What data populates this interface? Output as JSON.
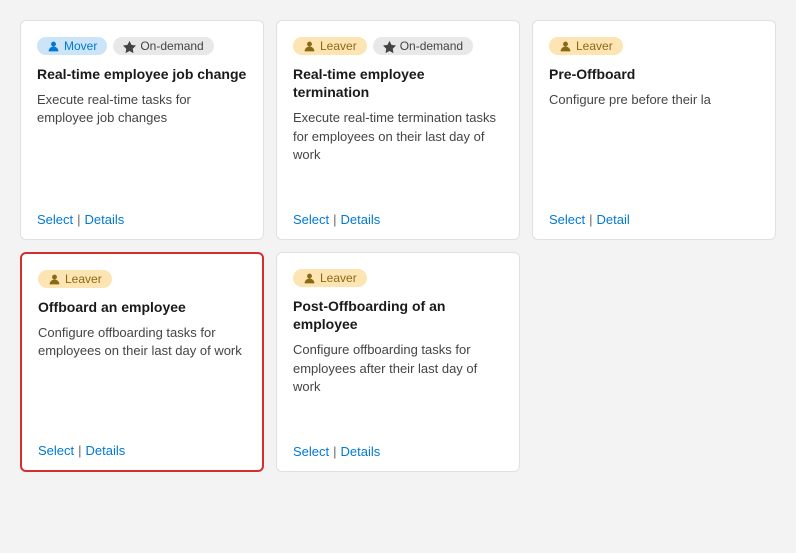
{
  "cards": [
    {
      "id": "card-1",
      "tags": [
        {
          "type": "mover",
          "label": "Mover",
          "icon": "👤"
        },
        {
          "type": "ondemand",
          "label": "On-demand",
          "icon": "⚡"
        }
      ],
      "title": "Real-time employee job change",
      "desc": "Execute real-time tasks for employee job changes",
      "select_label": "Select",
      "details_label": "Details",
      "selected": false,
      "clipped": false,
      "row": 1,
      "col": 1
    },
    {
      "id": "card-2",
      "tags": [
        {
          "type": "leaver",
          "label": "Leaver",
          "icon": "👤"
        },
        {
          "type": "ondemand",
          "label": "On-demand",
          "icon": "⚡"
        }
      ],
      "title": "Real-time employee termination",
      "desc": "Execute real-time termination tasks for employees on their last day of work",
      "select_label": "Select",
      "details_label": "Details",
      "selected": false,
      "clipped": false,
      "row": 1,
      "col": 2
    },
    {
      "id": "card-3",
      "tags": [
        {
          "type": "leaver",
          "label": "Leaver",
          "icon": "👤"
        }
      ],
      "title": "Pre-Offboard",
      "desc": "Configure pre before their la",
      "select_label": "Select",
      "details_label": "Detail",
      "selected": false,
      "clipped": true,
      "row": 1,
      "col": 3
    },
    {
      "id": "card-4",
      "tags": [
        {
          "type": "leaver",
          "label": "Leaver",
          "icon": "👤"
        }
      ],
      "title": "Offboard an employee",
      "desc": "Configure offboarding tasks for employees on their last day of work",
      "select_label": "Select",
      "details_label": "Details",
      "selected": true,
      "clipped": false,
      "row": 2,
      "col": 1
    },
    {
      "id": "card-5",
      "tags": [
        {
          "type": "leaver",
          "label": "Leaver",
          "icon": "👤"
        }
      ],
      "title": "Post-Offboarding of an employee",
      "desc": "Configure offboarding tasks for employees after their last day of work",
      "select_label": "Select",
      "details_label": "Details",
      "selected": false,
      "clipped": false,
      "row": 2,
      "col": 2
    }
  ],
  "tag_styles": {
    "mover": "tag-mover",
    "leaver": "tag-leaver",
    "ondemand": "tag-ondemand"
  }
}
